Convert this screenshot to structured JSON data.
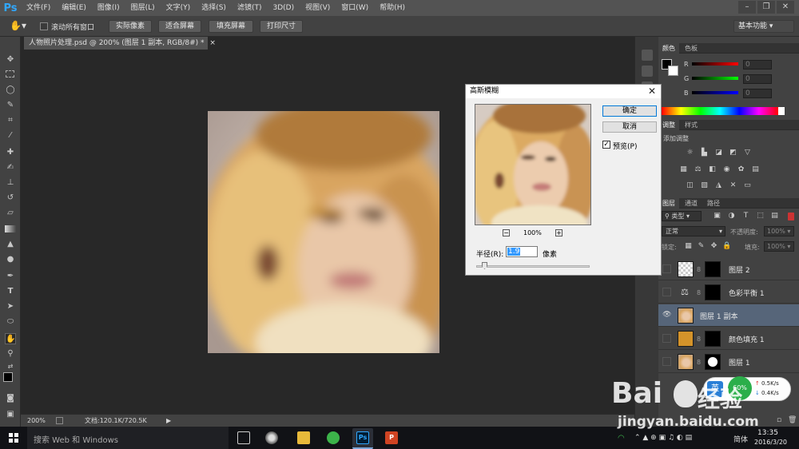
{
  "app": {
    "logo": "Ps",
    "menus": [
      "文件(F)",
      "编辑(E)",
      "图像(I)",
      "图层(L)",
      "文字(Y)",
      "选择(S)",
      "滤镜(T)",
      "3D(D)",
      "视图(V)",
      "窗口(W)",
      "帮助(H)"
    ]
  },
  "options": {
    "scroll_all_label": "滚动所有窗口",
    "actual_pixels": "实际像素",
    "fit_screen": "适合屏幕",
    "fill_screen": "填充屏幕",
    "print_size": "打印尺寸",
    "workspace": "基本功能"
  },
  "document": {
    "tab_title": "人物照片处理.psd @ 200% (图层 1 副本, RGB/8#) *",
    "zoom": "200%",
    "doc_info": "文档:120.1K/720.5K"
  },
  "color_panel": {
    "tabs": [
      "颜色",
      "色板"
    ],
    "channels": [
      "R",
      "G",
      "B"
    ],
    "values": [
      "0",
      "0",
      "0"
    ]
  },
  "adjust_panel": {
    "tabs": [
      "调整",
      "样式"
    ],
    "hint": "添加调整"
  },
  "layers_panel": {
    "tabs": [
      "图层",
      "通道",
      "路径"
    ],
    "filter_label": "类型",
    "blend_mode": "正常",
    "opacity_label": "不透明度:",
    "opacity": "100%",
    "lock_label": "锁定:",
    "fill_label": "填充:",
    "fill": "100%",
    "layers": [
      {
        "name": "图层 2",
        "visible": false,
        "selected": false
      },
      {
        "name": "色彩平衡 1",
        "visible": false,
        "selected": false
      },
      {
        "name": "图层 1 副本",
        "visible": true,
        "selected": true
      },
      {
        "name": "颜色填充 1",
        "visible": false,
        "selected": false
      },
      {
        "name": "图层 1",
        "visible": false,
        "selected": false
      }
    ]
  },
  "dialog": {
    "title": "高斯模糊",
    "ok": "确定",
    "cancel": "取消",
    "preview_label": "预览(P)",
    "preview_checked": true,
    "zoom": "100%",
    "radius_label": "半径(R):",
    "radius_value": "1.9",
    "radius_unit": "像素"
  },
  "taskbar": {
    "search_placeholder": "搜索 Web 和 Windows",
    "ime": "简体",
    "time": "13:35",
    "date": "2016/3/20"
  },
  "netspeed": {
    "ime_badge": "英",
    "up": "0.5K/s",
    "down": "0.4K/s",
    "cpu": "60%"
  },
  "watermark": {
    "brand": "Bai",
    "brand_cn": "经验",
    "url": "jingyan.baidu.com"
  },
  "colors": {
    "accent": "#0078d7",
    "ps_blue": "#31a8ff",
    "selected_layer": "#566579",
    "fill_orange": "#d4932a"
  }
}
